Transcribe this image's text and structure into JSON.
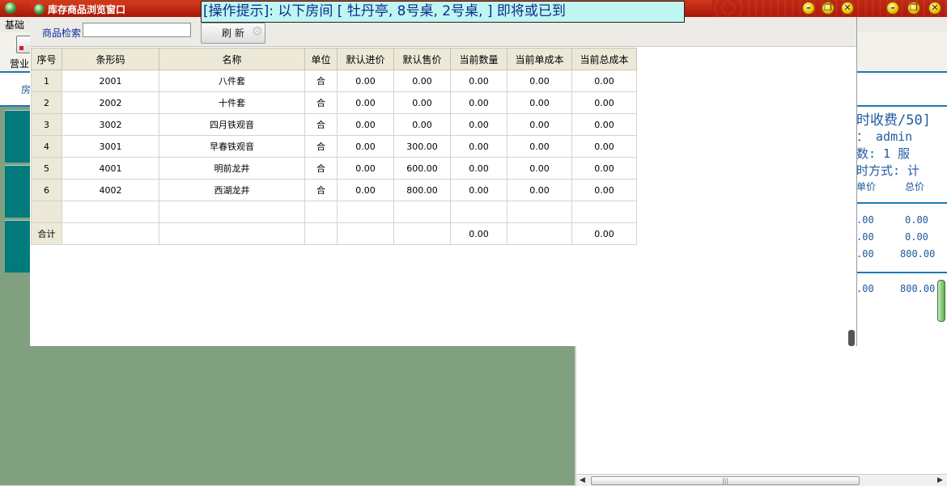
{
  "main_window": {
    "title": "",
    "menu_first": "基础",
    "toolbar_button_label": "营业",
    "room_strip_label": "房",
    "right_panel": {
      "header": "时收费/50]",
      "info_lines": [
        "： admin",
        "数: 1  服",
        "时方式: 计"
      ],
      "price_headers": [
        "单价",
        "总价"
      ],
      "price_rows": [
        {
          "unit": ".00",
          "total": "0.00"
        },
        {
          "unit": ".00",
          "total": "0.00"
        },
        {
          "unit": ".00",
          "total": "800.00"
        }
      ],
      "sum_row": {
        "unit": ".00",
        "total": "800.00"
      }
    }
  },
  "window": {
    "title": "库存商品浏览窗口",
    "search_label": "商品检索",
    "search_value": "",
    "refresh_label": "刷 新"
  },
  "tip_banner": "[操作提示]: 以下房间 [ 牡丹亭, 8号桌, 2号桌, ] 即将或已到",
  "table": {
    "columns": [
      "序号",
      "条形码",
      "名称",
      "单位",
      "默认进价",
      "默认售价",
      "当前数量",
      "当前单成本",
      "当前总成本"
    ],
    "rows": [
      {
        "no": "1",
        "barcode": "2001",
        "name": "八件套",
        "unit": "合",
        "cost": "0.00",
        "price": "0.00",
        "qty": "0.00",
        "unit_cost": "0.00",
        "total_cost": "0.00"
      },
      {
        "no": "2",
        "barcode": "2002",
        "name": "十件套",
        "unit": "合",
        "cost": "0.00",
        "price": "0.00",
        "qty": "0.00",
        "unit_cost": "0.00",
        "total_cost": "0.00"
      },
      {
        "no": "3",
        "barcode": "3002",
        "name": "四月铁观音",
        "unit": "合",
        "cost": "0.00",
        "price": "0.00",
        "qty": "0.00",
        "unit_cost": "0.00",
        "total_cost": "0.00"
      },
      {
        "no": "4",
        "barcode": "3001",
        "name": "早春铁观音",
        "unit": "合",
        "cost": "0.00",
        "price": "300.00",
        "qty": "0.00",
        "unit_cost": "0.00",
        "total_cost": "0.00"
      },
      {
        "no": "5",
        "barcode": "4001",
        "name": "明前龙井",
        "unit": "合",
        "cost": "0.00",
        "price": "600.00",
        "qty": "0.00",
        "unit_cost": "0.00",
        "total_cost": "0.00"
      },
      {
        "no": "6",
        "barcode": "4002",
        "name": "西湖龙井",
        "unit": "合",
        "cost": "0.00",
        "price": "800.00",
        "qty": "0.00",
        "unit_cost": "0.00",
        "total_cost": "0.00"
      }
    ],
    "total_label": "合计",
    "total_qty": "0.00",
    "total_cost": "0.00"
  },
  "colors": {
    "title_red": "#b81e0e",
    "banner_bg": "#bff6f2",
    "panel_green": "#80a080",
    "tile_teal": "#007a7a",
    "accent_blue": "#1e78b4"
  }
}
